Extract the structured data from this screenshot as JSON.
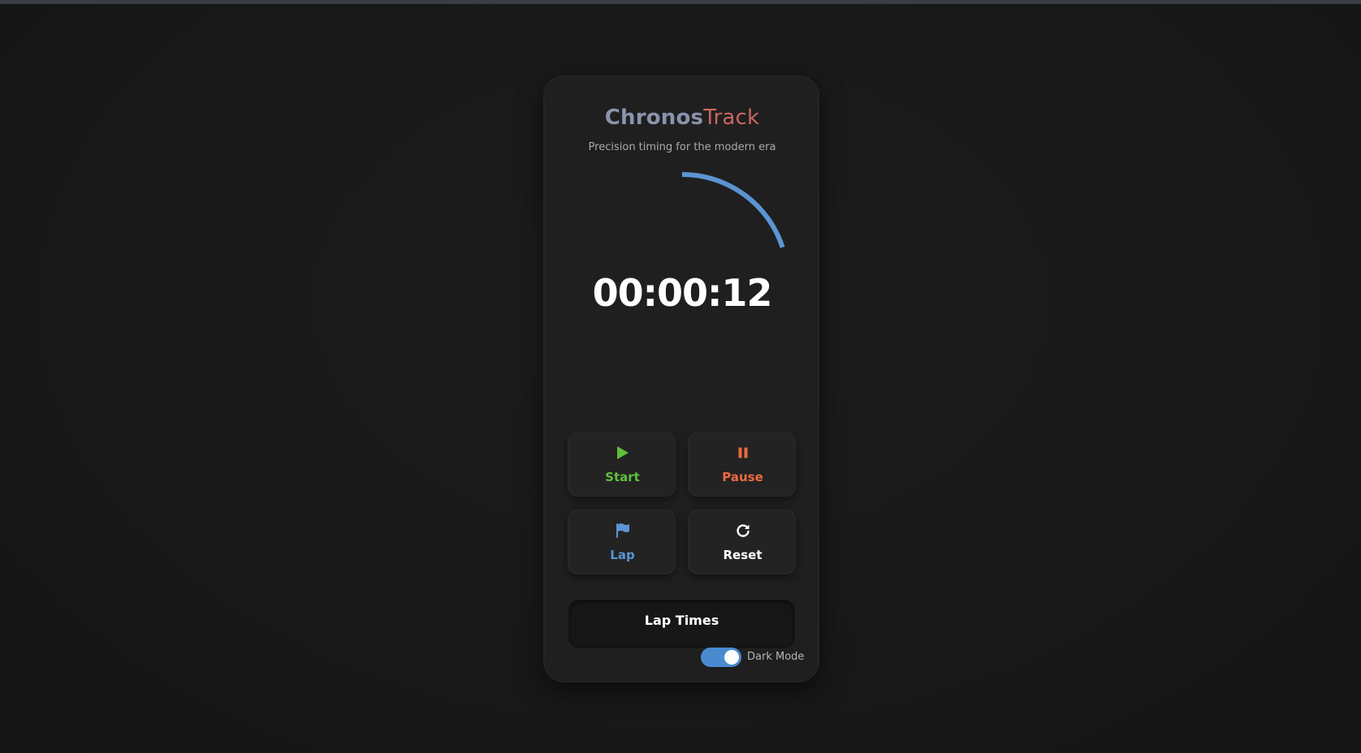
{
  "app": {
    "title_part1": "Chronos",
    "title_part2": "Track",
    "subtitle": "Precision timing for the modern era"
  },
  "timer": {
    "display": "00:00:12",
    "progress_seconds": 12,
    "cycle_seconds": 60
  },
  "controls": {
    "start": {
      "label": "Start",
      "icon": "play-icon",
      "color": "#5fbf3d"
    },
    "pause": {
      "label": "Pause",
      "icon": "pause-icon",
      "color": "#ec6a3f"
    },
    "lap": {
      "label": "Lap",
      "icon": "flag-icon",
      "color": "#5b95d3"
    },
    "reset": {
      "label": "Reset",
      "icon": "refresh-icon",
      "color": "#ffffff"
    }
  },
  "laps": {
    "title": "Lap Times",
    "items": []
  },
  "settings": {
    "dark_mode_label": "Dark Mode",
    "dark_mode_on": true
  },
  "colors": {
    "accent": "#4a8bd0",
    "title_primary": "#8b93ad",
    "title_secondary": "#c9685f"
  }
}
